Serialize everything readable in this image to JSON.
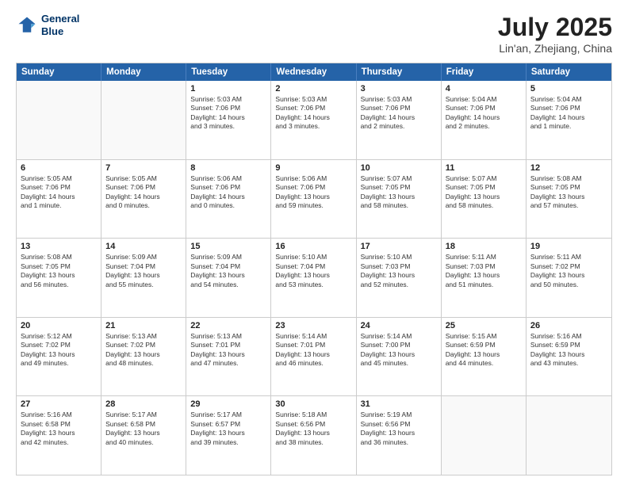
{
  "header": {
    "logo_line1": "General",
    "logo_line2": "Blue",
    "title": "July 2025",
    "subtitle": "Lin'an, Zhejiang, China"
  },
  "calendar": {
    "days_of_week": [
      "Sunday",
      "Monday",
      "Tuesday",
      "Wednesday",
      "Thursday",
      "Friday",
      "Saturday"
    ],
    "weeks": [
      [
        {
          "day": "",
          "info": ""
        },
        {
          "day": "",
          "info": ""
        },
        {
          "day": "1",
          "info": "Sunrise: 5:03 AM\nSunset: 7:06 PM\nDaylight: 14 hours\nand 3 minutes."
        },
        {
          "day": "2",
          "info": "Sunrise: 5:03 AM\nSunset: 7:06 PM\nDaylight: 14 hours\nand 3 minutes."
        },
        {
          "day": "3",
          "info": "Sunrise: 5:03 AM\nSunset: 7:06 PM\nDaylight: 14 hours\nand 2 minutes."
        },
        {
          "day": "4",
          "info": "Sunrise: 5:04 AM\nSunset: 7:06 PM\nDaylight: 14 hours\nand 2 minutes."
        },
        {
          "day": "5",
          "info": "Sunrise: 5:04 AM\nSunset: 7:06 PM\nDaylight: 14 hours\nand 1 minute."
        }
      ],
      [
        {
          "day": "6",
          "info": "Sunrise: 5:05 AM\nSunset: 7:06 PM\nDaylight: 14 hours\nand 1 minute."
        },
        {
          "day": "7",
          "info": "Sunrise: 5:05 AM\nSunset: 7:06 PM\nDaylight: 14 hours\nand 0 minutes."
        },
        {
          "day": "8",
          "info": "Sunrise: 5:06 AM\nSunset: 7:06 PM\nDaylight: 14 hours\nand 0 minutes."
        },
        {
          "day": "9",
          "info": "Sunrise: 5:06 AM\nSunset: 7:06 PM\nDaylight: 13 hours\nand 59 minutes."
        },
        {
          "day": "10",
          "info": "Sunrise: 5:07 AM\nSunset: 7:05 PM\nDaylight: 13 hours\nand 58 minutes."
        },
        {
          "day": "11",
          "info": "Sunrise: 5:07 AM\nSunset: 7:05 PM\nDaylight: 13 hours\nand 58 minutes."
        },
        {
          "day": "12",
          "info": "Sunrise: 5:08 AM\nSunset: 7:05 PM\nDaylight: 13 hours\nand 57 minutes."
        }
      ],
      [
        {
          "day": "13",
          "info": "Sunrise: 5:08 AM\nSunset: 7:05 PM\nDaylight: 13 hours\nand 56 minutes."
        },
        {
          "day": "14",
          "info": "Sunrise: 5:09 AM\nSunset: 7:04 PM\nDaylight: 13 hours\nand 55 minutes."
        },
        {
          "day": "15",
          "info": "Sunrise: 5:09 AM\nSunset: 7:04 PM\nDaylight: 13 hours\nand 54 minutes."
        },
        {
          "day": "16",
          "info": "Sunrise: 5:10 AM\nSunset: 7:04 PM\nDaylight: 13 hours\nand 53 minutes."
        },
        {
          "day": "17",
          "info": "Sunrise: 5:10 AM\nSunset: 7:03 PM\nDaylight: 13 hours\nand 52 minutes."
        },
        {
          "day": "18",
          "info": "Sunrise: 5:11 AM\nSunset: 7:03 PM\nDaylight: 13 hours\nand 51 minutes."
        },
        {
          "day": "19",
          "info": "Sunrise: 5:11 AM\nSunset: 7:02 PM\nDaylight: 13 hours\nand 50 minutes."
        }
      ],
      [
        {
          "day": "20",
          "info": "Sunrise: 5:12 AM\nSunset: 7:02 PM\nDaylight: 13 hours\nand 49 minutes."
        },
        {
          "day": "21",
          "info": "Sunrise: 5:13 AM\nSunset: 7:02 PM\nDaylight: 13 hours\nand 48 minutes."
        },
        {
          "day": "22",
          "info": "Sunrise: 5:13 AM\nSunset: 7:01 PM\nDaylight: 13 hours\nand 47 minutes."
        },
        {
          "day": "23",
          "info": "Sunrise: 5:14 AM\nSunset: 7:01 PM\nDaylight: 13 hours\nand 46 minutes."
        },
        {
          "day": "24",
          "info": "Sunrise: 5:14 AM\nSunset: 7:00 PM\nDaylight: 13 hours\nand 45 minutes."
        },
        {
          "day": "25",
          "info": "Sunrise: 5:15 AM\nSunset: 6:59 PM\nDaylight: 13 hours\nand 44 minutes."
        },
        {
          "day": "26",
          "info": "Sunrise: 5:16 AM\nSunset: 6:59 PM\nDaylight: 13 hours\nand 43 minutes."
        }
      ],
      [
        {
          "day": "27",
          "info": "Sunrise: 5:16 AM\nSunset: 6:58 PM\nDaylight: 13 hours\nand 42 minutes."
        },
        {
          "day": "28",
          "info": "Sunrise: 5:17 AM\nSunset: 6:58 PM\nDaylight: 13 hours\nand 40 minutes."
        },
        {
          "day": "29",
          "info": "Sunrise: 5:17 AM\nSunset: 6:57 PM\nDaylight: 13 hours\nand 39 minutes."
        },
        {
          "day": "30",
          "info": "Sunrise: 5:18 AM\nSunset: 6:56 PM\nDaylight: 13 hours\nand 38 minutes."
        },
        {
          "day": "31",
          "info": "Sunrise: 5:19 AM\nSunset: 6:56 PM\nDaylight: 13 hours\nand 36 minutes."
        },
        {
          "day": "",
          "info": ""
        },
        {
          "day": "",
          "info": ""
        }
      ]
    ]
  }
}
